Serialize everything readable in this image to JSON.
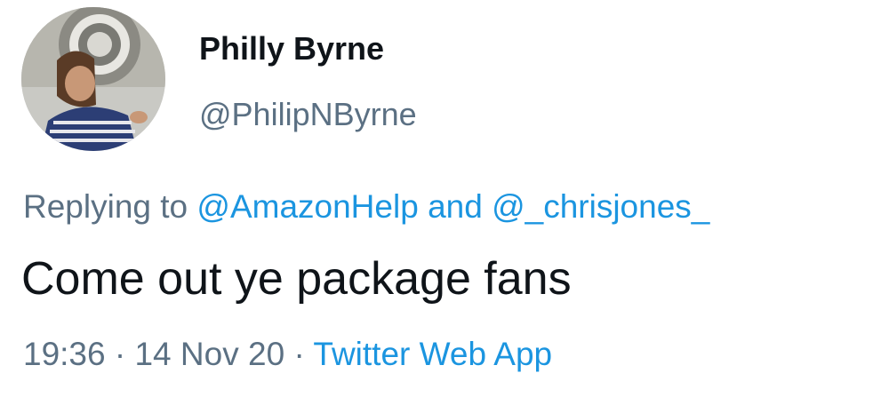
{
  "author": {
    "display_name": "Philly Byrne",
    "handle": "@PhilipNByrne",
    "avatar_icon": "profile-photo"
  },
  "reply": {
    "prefix": "Replying to",
    "mention_1": "@AmazonHelp",
    "conjunction": "and",
    "mention_2": "@_chrisjones_"
  },
  "tweet": {
    "text": "Come out ye package fans"
  },
  "meta": {
    "time": "19:36",
    "date": "14 Nov 20",
    "source": "Twitter Web App",
    "separator": "·"
  },
  "colors": {
    "text": "#0f1419",
    "secondary": "#5b7083",
    "link": "#1b95e0"
  }
}
